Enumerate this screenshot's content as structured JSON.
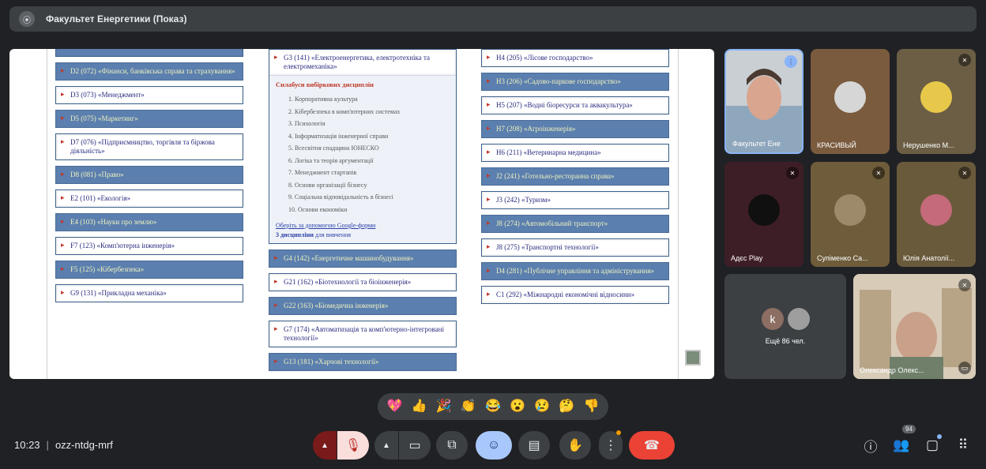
{
  "topbar": {
    "title": "Факультет Енергетики (Показ)"
  },
  "slide": {
    "col1": [
      {
        "code": "D2 (072) «Фінанси, банківська справа та страхування»",
        "style": "blue"
      },
      {
        "code": "D3 (073) «Менеджмент»",
        "style": "white"
      },
      {
        "code": "D5 (075) «Маркетинг»",
        "style": "blue"
      },
      {
        "code": "D7 (076) «Підприємництво, торгівля та біржова діяльність»",
        "style": "white"
      },
      {
        "code": "D8 (081) «Право»",
        "style": "blue"
      },
      {
        "code": "E2 (101) «Екологія»",
        "style": "white"
      },
      {
        "code": "E4 (103) «Науки про землю»",
        "style": "blue"
      },
      {
        "code": "F7 (123) «Комп'ютерна інженерія»",
        "style": "white"
      },
      {
        "code": "F5 (125) «Кібербезпека»",
        "style": "blue"
      },
      {
        "code": "G9 (131) «Прикладна механіка»",
        "style": "white"
      }
    ],
    "g3": {
      "code": "G3 (141) «Електроенергетика, електротехніка та електромеханіка»",
      "syllabus_title": "Силабуси вибіркових дисциплін",
      "items": [
        "1. Корпоративна культура",
        "2. Кібербезпека в комп'ютерних системах",
        "3. Психологія",
        "4. Інформатизація інженерної справи",
        "5. Всесвітня спадщина ЮНЕСКО",
        "6. Логіка та теорія аргументації",
        "7. Менеджмент стартапів",
        "8. Основи організації бізнесу",
        "9. Соціальна відповідальність в бізнесі",
        "10. Основи економіки"
      ],
      "link": "Оберіть за допомогою Google-форми",
      "note_bold": "3 дисципліни",
      "note_rest": " для вивчення"
    },
    "col2": [
      {
        "code": "G4 (142) «Енергетичне машинобудування»",
        "style": "blue"
      },
      {
        "code": "G21 (162) «Біотехнології та біоінженерія»",
        "style": "white"
      },
      {
        "code": "G22 (163) «Біомедична інженерія»",
        "style": "blue"
      },
      {
        "code": "G7 (174) «Автоматизація та комп'ютерно-інтегровані технології»",
        "style": "white"
      },
      {
        "code": "G13 (181) «Харчові технології»",
        "style": "blue"
      }
    ],
    "col3": [
      {
        "code": "H4 (205) «Лісове господарство»",
        "style": "white"
      },
      {
        "code": "H3 (206) «Садово-паркове господарство»",
        "style": "blue"
      },
      {
        "code": "H5 (207) «Водні біоресурси та аквакультура»",
        "style": "white"
      },
      {
        "code": "H7 (208) «Агроінженерія»",
        "style": "blue"
      },
      {
        "code": "H6 (211) «Ветеринарна медицина»",
        "style": "white"
      },
      {
        "code": "J2 (241) «Готельно-ресторанна справа»",
        "style": "blue"
      },
      {
        "code": "J3 (242) «Туризм»",
        "style": "white"
      },
      {
        "code": "J8 (274) «Автомобільний транспорт»",
        "style": "blue"
      },
      {
        "code": "J8 (275) «Транспортні технології»",
        "style": "white"
      },
      {
        "code": "D4 (281) «Публічне управління та адміністрування»",
        "style": "blue"
      },
      {
        "code": "C1 (292) «Міжнародні економічні відносини»",
        "style": "white"
      }
    ]
  },
  "participants": {
    "t1": "Факультет Ене",
    "t2": "КРАСИВЫЙ",
    "t3": "Нерушенко М...",
    "t4": "Адєс Play",
    "t5": "Супіменко Са...",
    "t6": "Юлія Анатолії...",
    "t7": "Ещё 86 чел.",
    "t7_initial": "k",
    "t8": "Олександр Олекс..."
  },
  "reactions": [
    "💖",
    "👍",
    "🎉",
    "👏",
    "😂",
    "😮",
    "😢",
    "🤔",
    "👎"
  ],
  "bottom": {
    "time": "10:23",
    "meeting_code": "ozz-ntdg-mrf",
    "participants_count": "94"
  },
  "colors": {
    "accent_blue": "#8ab4f8",
    "leave_red": "#ea4335",
    "slide_blue": "#5b7fae"
  }
}
